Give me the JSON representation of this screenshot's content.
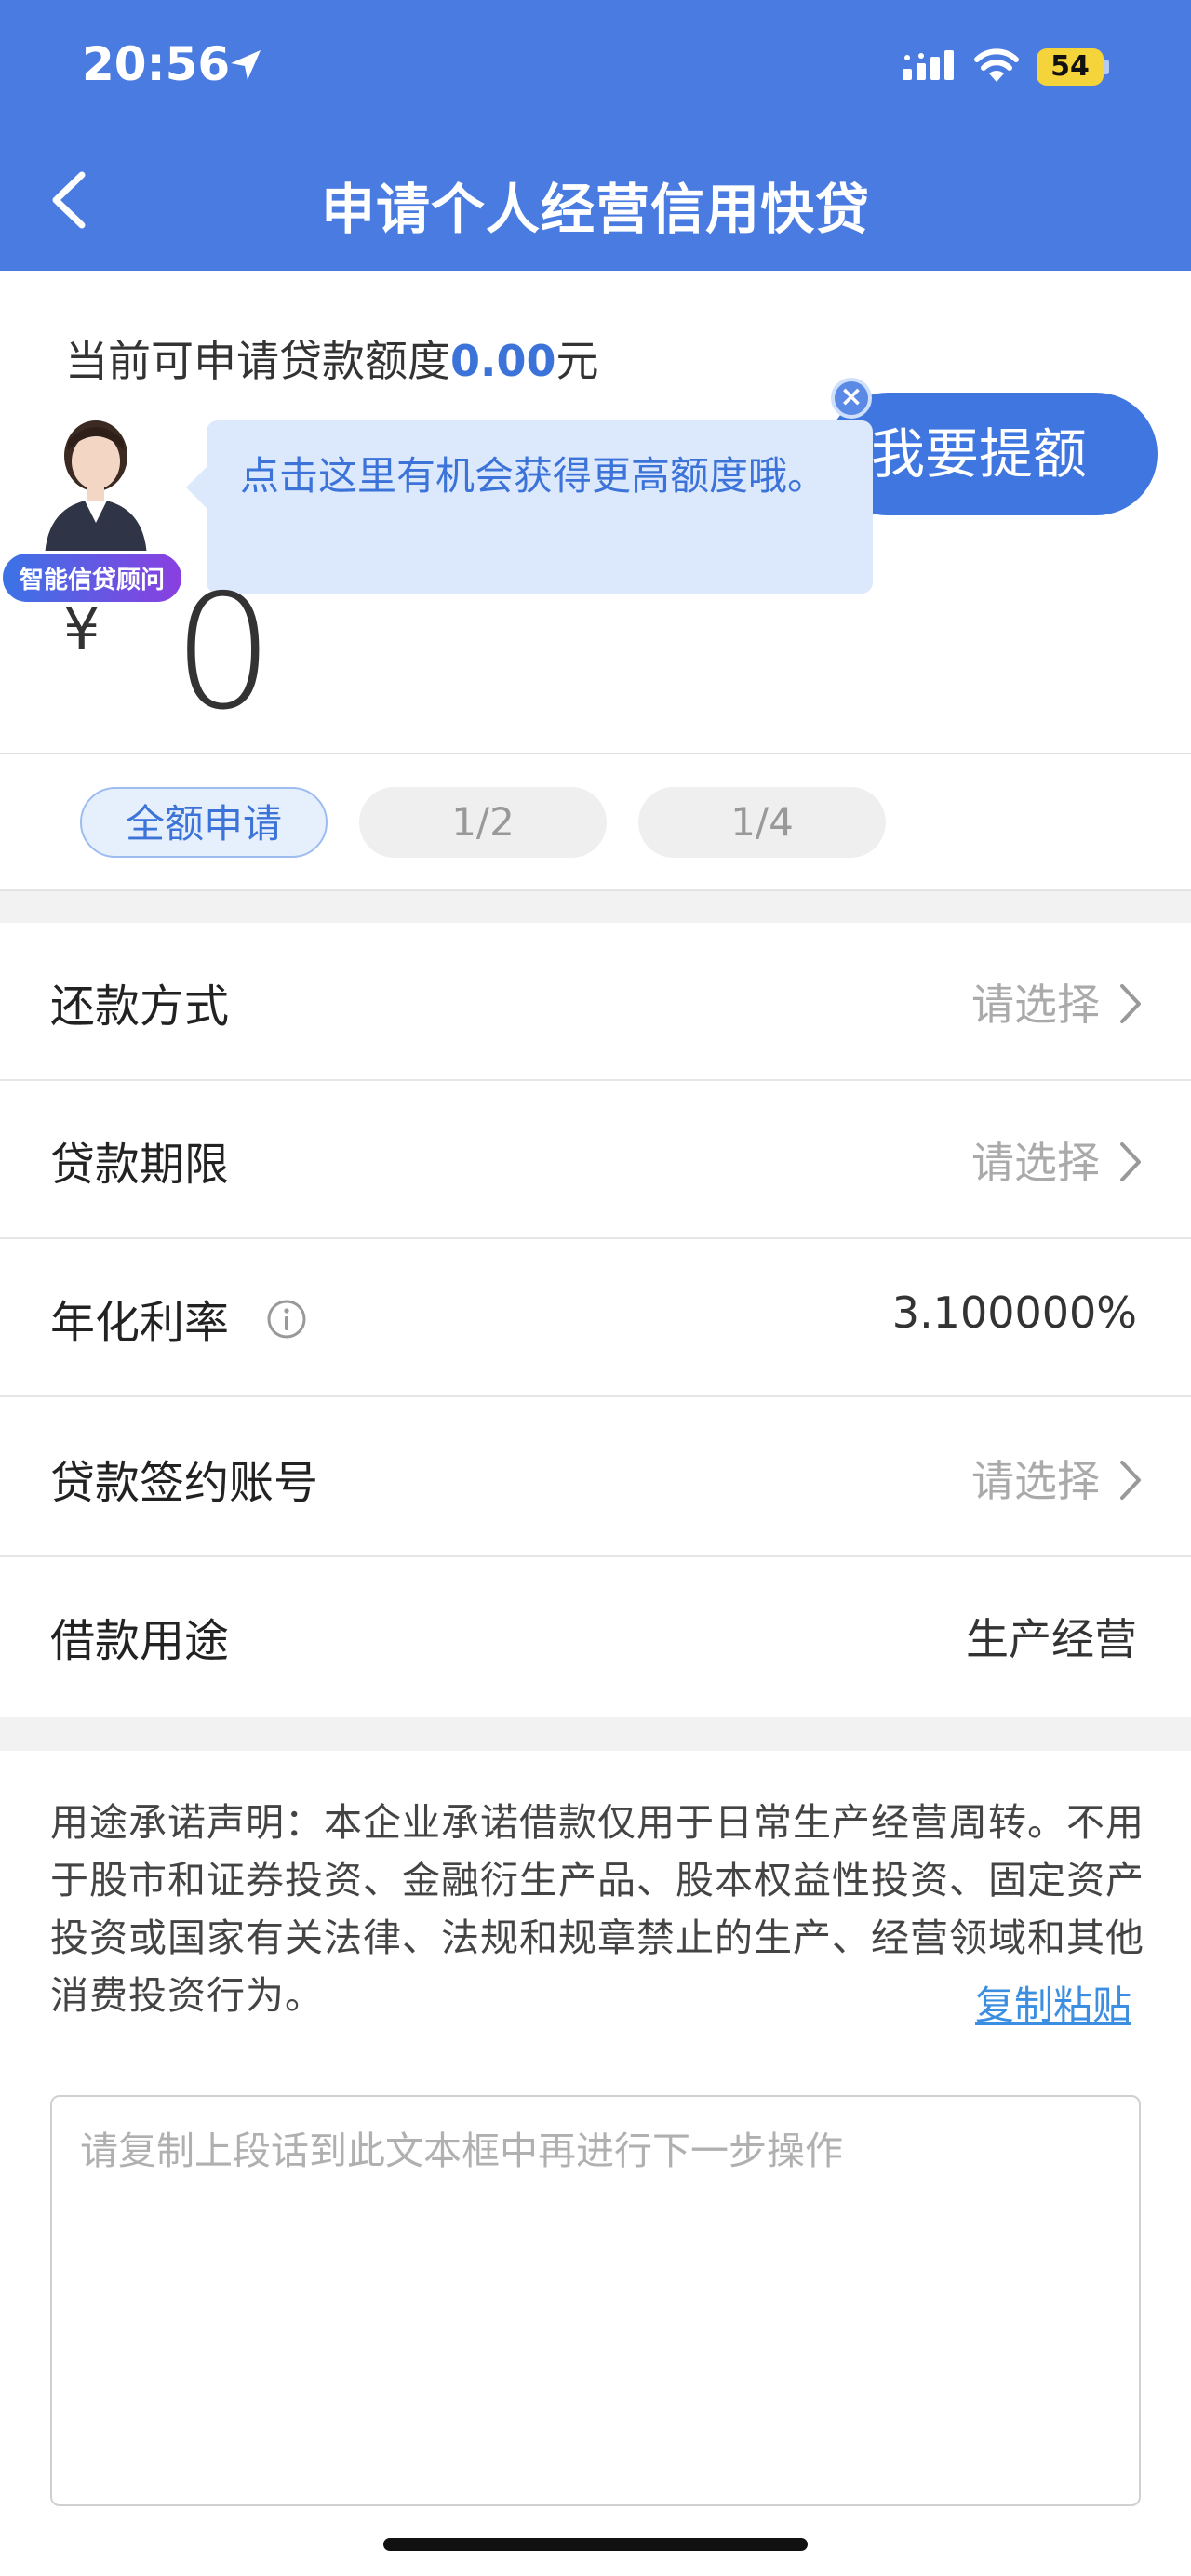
{
  "status_bar": {
    "time": "20:56",
    "battery": "54",
    "icons": [
      "location-arrow-icon",
      "signal-icon",
      "wifi-icon",
      "battery-icon"
    ]
  },
  "nav": {
    "title": "申请个人经营信用快贷",
    "back_icon": "chevron-left-icon"
  },
  "quota": {
    "prefix": "当前可申请贷款额度",
    "amount": "0.00",
    "suffix": "元"
  },
  "raise_button": "我要提额",
  "tip": {
    "text": "点击这里有机会获得更高额度哦。",
    "close_label": "×"
  },
  "advisor": {
    "badge": "智能信贷顾问"
  },
  "amount_input": {
    "currency": "¥",
    "value": "0"
  },
  "ratios": [
    {
      "label": "全额申请",
      "selected": true
    },
    {
      "label": "1/2",
      "selected": false
    },
    {
      "label": "1/4",
      "selected": false
    }
  ],
  "form": {
    "repayment": {
      "label": "还款方式",
      "placeholder": "请选择"
    },
    "term": {
      "label": "贷款期限",
      "placeholder": "请选择"
    },
    "rate": {
      "label": "年化利率",
      "value": "3.100000%"
    },
    "account": {
      "label": "贷款签约账号",
      "placeholder": "请选择"
    },
    "purpose": {
      "label": "借款用途",
      "value": "生产经营"
    }
  },
  "declaration": {
    "text": "用途承诺声明：本企业承诺借款仅用于日常生产经营周转。不用于股市和证券投资、金融衍生产品、股本权益性投资、固定资产投资或国家有关法律、法规和规章禁止的生产、经营领域和其他消费投资行为。",
    "copy_link": "复制粘贴",
    "textarea_placeholder": "请复制上段话到此文本框中再进行下一步操作"
  },
  "colors": {
    "header": "#4a7be0",
    "accent": "#3b73d9",
    "link": "#3b8ee0"
  }
}
